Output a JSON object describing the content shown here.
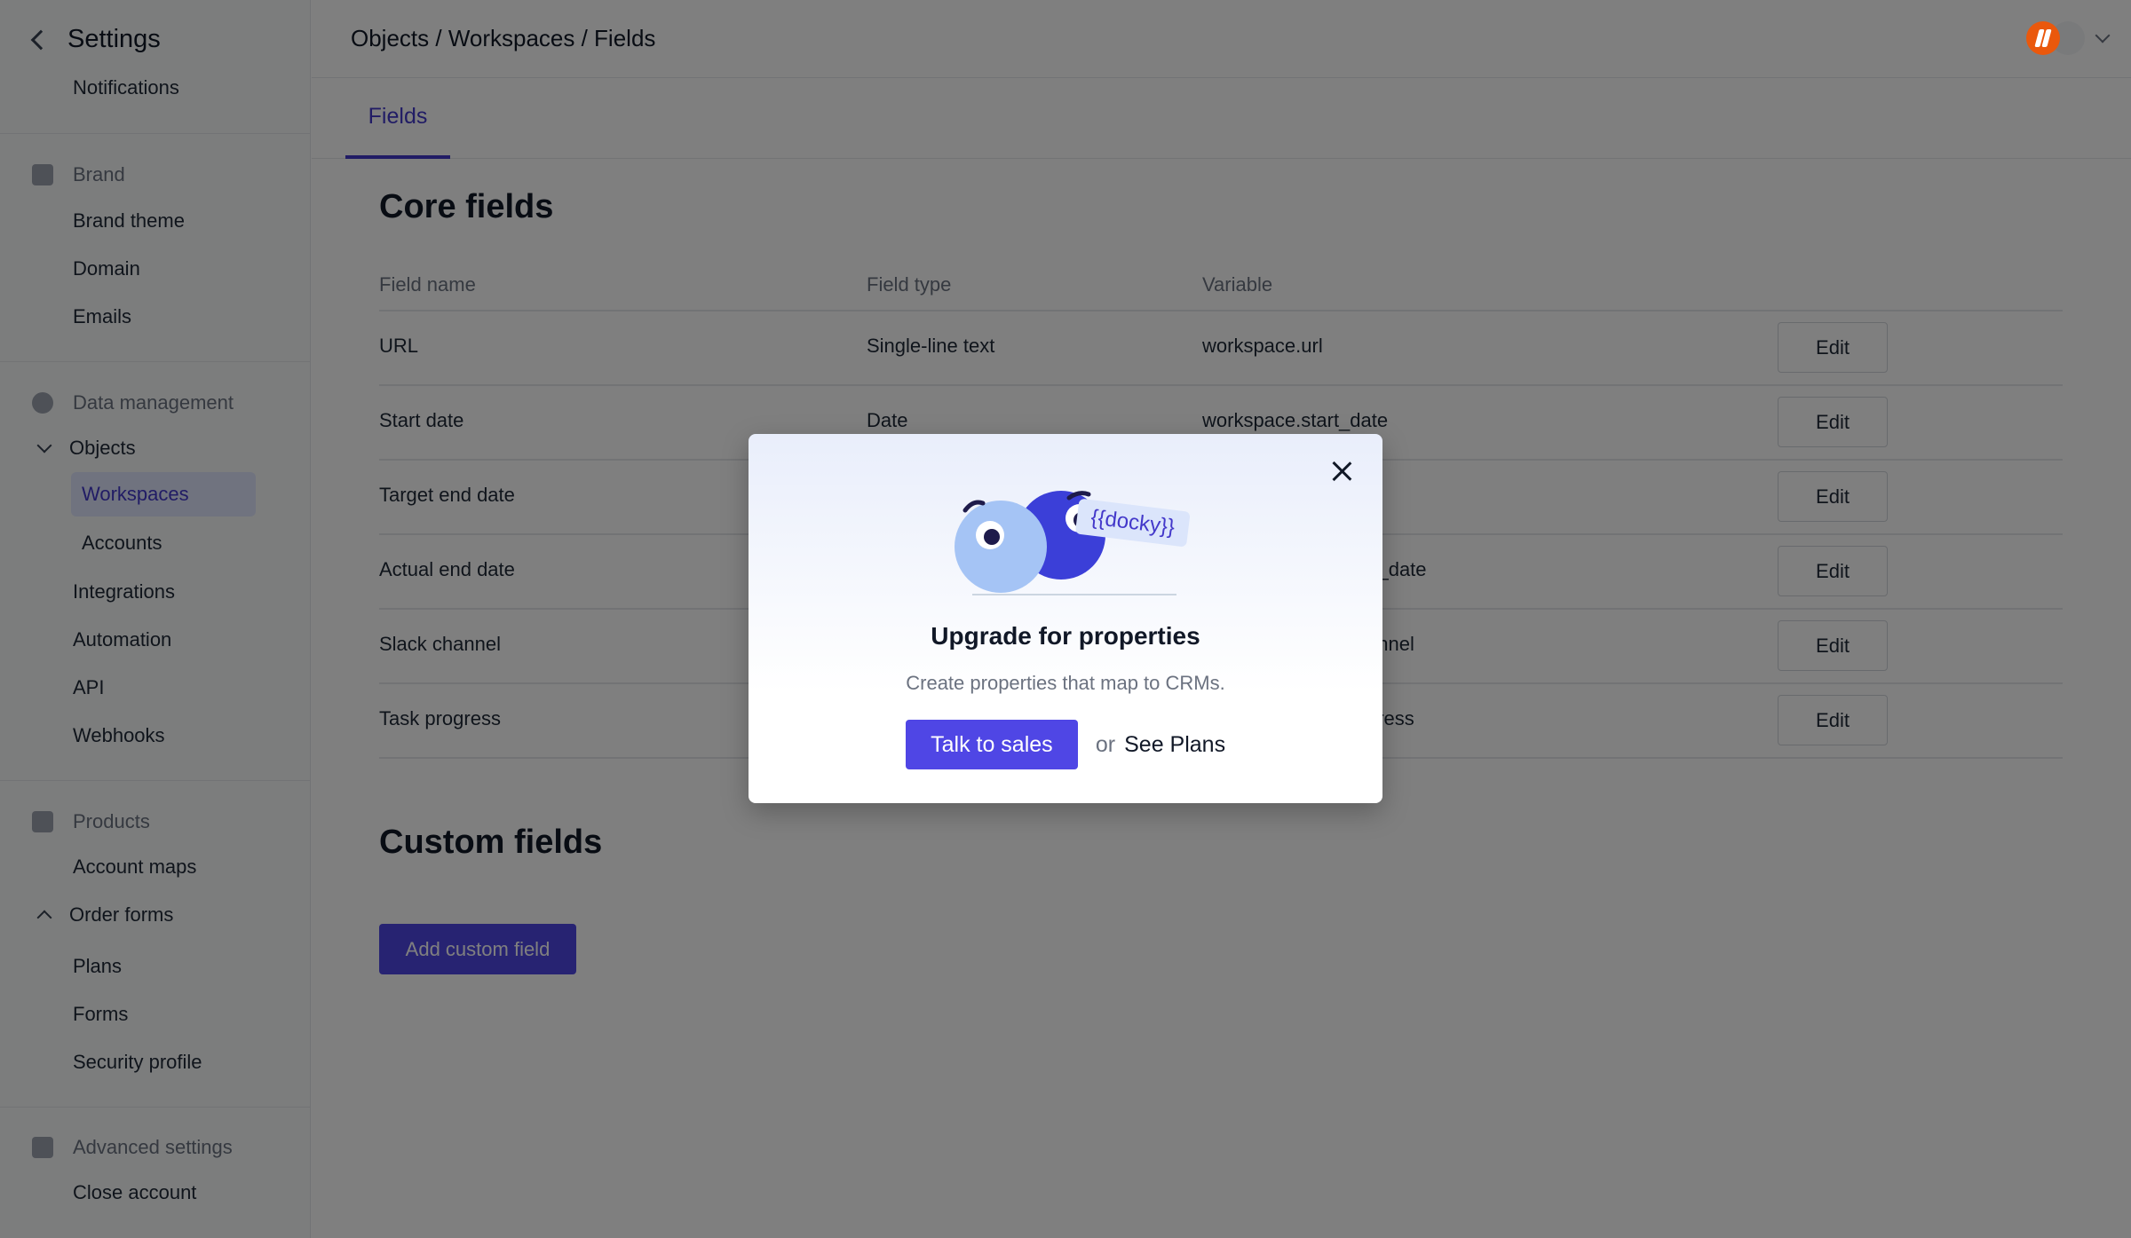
{
  "sidebar": {
    "title": "Settings",
    "notifications": "Notifications",
    "brand": {
      "label": "Brand",
      "items": [
        "Brand theme",
        "Domain",
        "Emails"
      ]
    },
    "data_management": {
      "label": "Data management",
      "objects": "Objects",
      "workspaces": "Workspaces",
      "accounts": "Accounts",
      "items": [
        "Integrations",
        "Automation",
        "API",
        "Webhooks"
      ]
    },
    "products": {
      "label": "Products",
      "account_maps": "Account maps",
      "order_forms": "Order forms",
      "items": [
        "Plans",
        "Forms",
        "Security profile"
      ]
    },
    "advanced": {
      "label": "Advanced settings",
      "close_account": "Close account"
    }
  },
  "header": {
    "breadcrumb": "Objects / Workspaces / Fields"
  },
  "tabs": [
    "Fields"
  ],
  "core": {
    "title": "Core fields",
    "columns": [
      "Field name",
      "Field type",
      "Variable"
    ],
    "rows": [
      {
        "name": "URL",
        "type": "Single-line text",
        "variable": "workspace.url"
      },
      {
        "name": "Start date",
        "type": "Date",
        "variable": "workspace.start_date"
      },
      {
        "name": "Target end date",
        "type": "",
        "variable": "e"
      },
      {
        "name": "Actual end date",
        "type": "",
        "variable": "nd_date"
      },
      {
        "name": "Slack channel",
        "type": "",
        "variable": "annel"
      },
      {
        "name": "Task progress",
        "type": "",
        "variable": "gress"
      }
    ],
    "edit_label": "Edit"
  },
  "custom": {
    "title": "Custom fields",
    "add_label": "Add custom field"
  },
  "modal": {
    "badge": "{{docky}}",
    "title": "Upgrade for properties",
    "subtitle": "Create properties that map to CRMs.",
    "talk_label": "Talk to sales",
    "or_label": "or",
    "plans_label": "See Plans"
  },
  "colors": {
    "accent": "#4f46e5",
    "active_bg": "#e0e7ff",
    "logo": "#ea580c"
  }
}
